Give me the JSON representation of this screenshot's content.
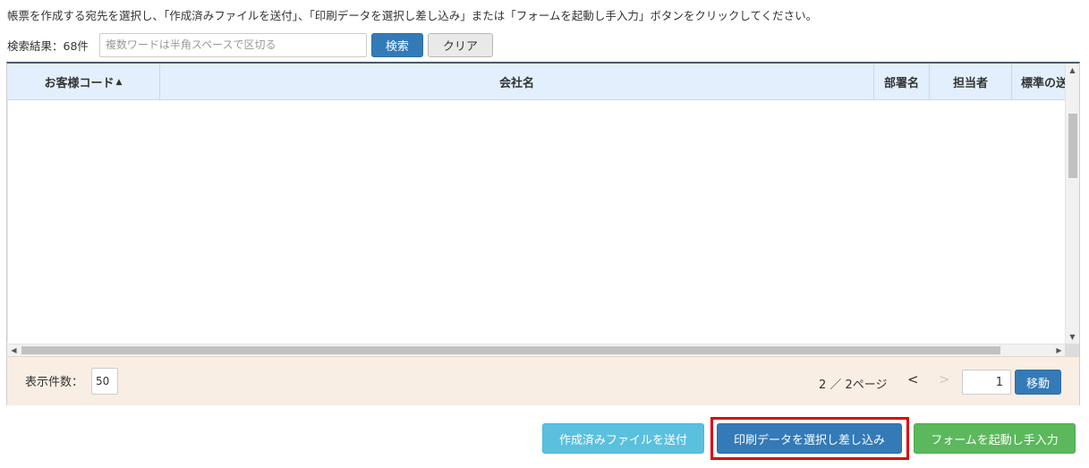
{
  "instruction": "帳票を作成する宛先を選択し、「作成済みファイルを送付」、「印刷データを選択し差し込み」または「フォームを起動し手入力」ボタンをクリックしてください。",
  "search": {
    "result_count": "検索結果：68件",
    "placeholder": "複数ワードは半角スペースで区切る",
    "value": "",
    "search_button": "検索",
    "clear_button": "クリア"
  },
  "grid": {
    "columns": [
      {
        "label": "お客様コード",
        "sort": "▲"
      },
      {
        "label": "会社名"
      },
      {
        "label": "部署名"
      },
      {
        "label": "担当者"
      },
      {
        "label": "標準の送"
      }
    ],
    "rows": []
  },
  "scroll": {
    "up": "▲",
    "down": "▼",
    "left": "◀",
    "right": "▶"
  },
  "pager": {
    "page_size_label": "表示件数：",
    "page_size": "50",
    "page_info": "2 ／ 2ページ",
    "prev": "<",
    "next": ">",
    "page_input": "1",
    "move_button": "移動"
  },
  "actions": {
    "send_file": "作成済みファイルを送付",
    "print_data": "印刷データを選択し差し込み",
    "form_input": "フォームを起動し手入力",
    "highlight_color": "#e3000f"
  }
}
